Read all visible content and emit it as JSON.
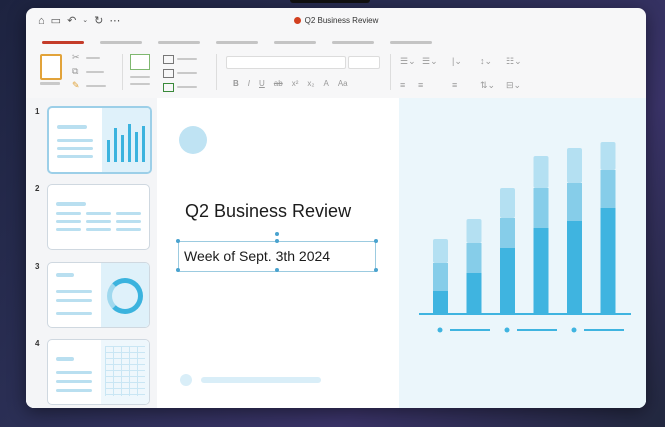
{
  "window": {
    "title": "Q2 Business Review"
  },
  "titlebar_icons": [
    "home-icon",
    "save-icon",
    "undo-icon",
    "chevron-down-icon",
    "redo-icon",
    "more-icon"
  ],
  "slides": [
    {
      "number": "1",
      "layout": "title-chart",
      "selected": true
    },
    {
      "number": "2",
      "layout": "text-columns",
      "selected": false
    },
    {
      "number": "3",
      "layout": "text-donut",
      "selected": false
    },
    {
      "number": "4",
      "layout": "text-table",
      "selected": false
    }
  ],
  "ribbon": {
    "font_buttons": [
      "B",
      "I",
      "U",
      "ab",
      "x²",
      "x₂",
      "A",
      "Aa"
    ]
  },
  "slide": {
    "title": "Q2 Business Review",
    "subtitle": "Week of Sept. 3th 2024"
  },
  "chart_data": {
    "type": "bar",
    "stacked": true,
    "categories": [
      "",
      "",
      "",
      "",
      "",
      ""
    ],
    "series": [
      {
        "values": [
          22,
          40,
          65,
          85,
          92,
          105
        ]
      },
      {
        "values": [
          28,
          30,
          30,
          40,
          38,
          38
        ]
      },
      {
        "values": [
          24,
          24,
          30,
          32,
          35,
          28
        ]
      }
    ],
    "colors": [
      "#3fb4e0",
      "#86cde9",
      "#b4e0f2"
    ],
    "xlabel": "",
    "ylabel": "",
    "ylim": [
      0,
      175
    ],
    "grid": false
  },
  "colors": {
    "accent": "#c43c2a",
    "chart_primary": "#3fb4e0"
  }
}
